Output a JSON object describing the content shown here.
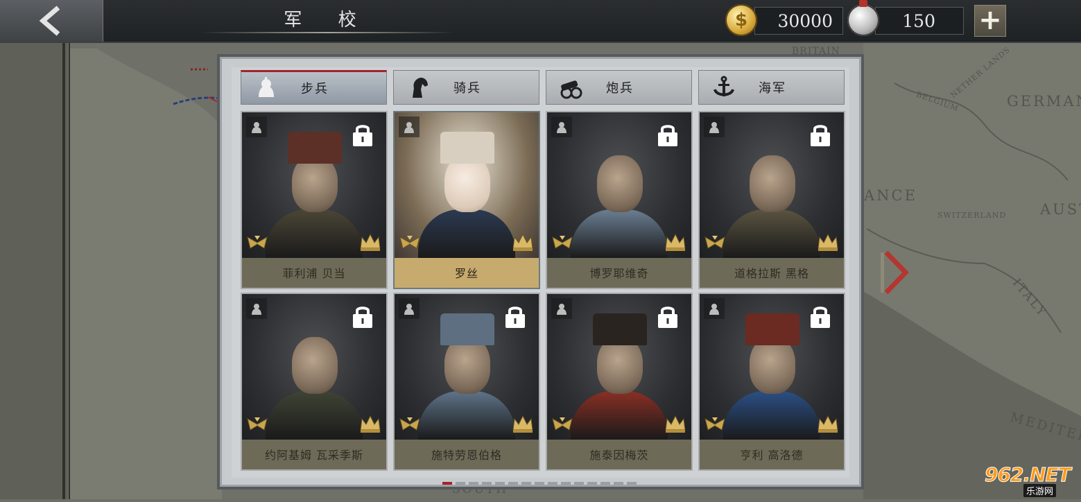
{
  "header": {
    "title": "军 校",
    "gold": "30000",
    "gold_symbol": "$",
    "silver": "150",
    "add_symbol": "+"
  },
  "map": {
    "labels": [
      "GERMANY",
      "ANCE",
      "AUST",
      "BELGIUM",
      "NETHER LANDS",
      "SWITZERLAND",
      "ITALY",
      "MEDITERR",
      "SOUTH",
      "BRITAIN"
    ]
  },
  "tabs": [
    {
      "label": "步兵",
      "icon": "infantry-helmet-icon",
      "active": true
    },
    {
      "label": "骑兵",
      "icon": "horse-head-icon",
      "active": false
    },
    {
      "label": "炮兵",
      "icon": "cannon-icon",
      "active": false
    },
    {
      "label": "海军",
      "icon": "anchor-icon",
      "active": false
    }
  ],
  "generals": [
    {
      "name": "菲利浦 贝当",
      "locked": true,
      "selected": false,
      "uniform": "#4a4636",
      "hat": "#5c2f27"
    },
    {
      "name": "罗丝",
      "locked": false,
      "selected": true,
      "uniform": "#2c3a52",
      "hat": "#d8cfc0"
    },
    {
      "name": "博罗耶维奇",
      "locked": true,
      "selected": false,
      "uniform": "#6b7f93",
      "hat": "none"
    },
    {
      "name": "道格拉斯 黑格",
      "locked": true,
      "selected": false,
      "uniform": "#5a5440",
      "hat": "none"
    },
    {
      "name": "约阿基姆 瓦采季斯",
      "locked": true,
      "selected": false,
      "uniform": "#3f4434",
      "hat": "none"
    },
    {
      "name": "施特劳恩伯格",
      "locked": true,
      "selected": false,
      "uniform": "#5e7489",
      "hat": "#5d6f80"
    },
    {
      "name": "施泰因梅茨",
      "locked": true,
      "selected": false,
      "uniform": "#8a2f24",
      "hat": "#2a2420"
    },
    {
      "name": "亨利 高洛德",
      "locked": true,
      "selected": false,
      "uniform": "#2b4f86",
      "hat": "#6b2a22"
    }
  ],
  "pager": {
    "pages": 15,
    "current": 1
  },
  "watermark": {
    "main": "962.NET",
    "sub": "乐游网"
  },
  "colors": {
    "accent": "#a1252b",
    "selected_name_bg": "#c7aa6e",
    "name_bg": "#6e6a58"
  }
}
